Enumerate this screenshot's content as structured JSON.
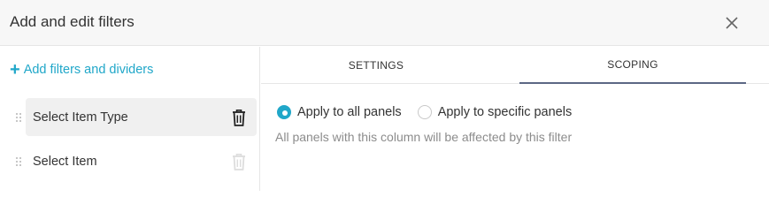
{
  "header": {
    "title": "Add and edit filters",
    "close_icon": "close-icon"
  },
  "sidebar": {
    "add_label": "Add filters and dividers",
    "accent_color": "#20a7c9",
    "filters": [
      {
        "label": "Select Item Type",
        "active": true
      },
      {
        "label": "Select Item",
        "active": false
      }
    ]
  },
  "tabs": [
    {
      "label": "SETTINGS",
      "active": false
    },
    {
      "label": "SCOPING",
      "active": true
    }
  ],
  "scoping": {
    "options": [
      {
        "label": "Apply to all panels",
        "checked": true
      },
      {
        "label": "Apply to specific panels",
        "checked": false
      }
    ],
    "hint": "All panels with this column will be affected by this filter"
  }
}
